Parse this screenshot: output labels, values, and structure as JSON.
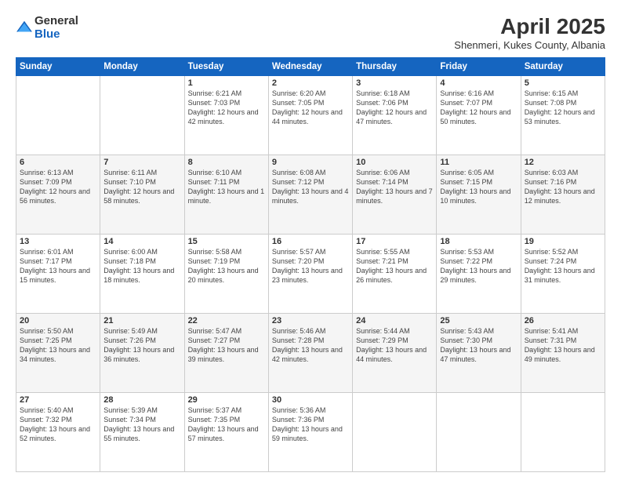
{
  "logo": {
    "text_general": "General",
    "text_blue": "Blue"
  },
  "title": "April 2025",
  "subtitle": "Shenmeri, Kukes County, Albania",
  "days": [
    "Sunday",
    "Monday",
    "Tuesday",
    "Wednesday",
    "Thursday",
    "Friday",
    "Saturday"
  ],
  "weeks": [
    [
      {
        "day": "",
        "info": ""
      },
      {
        "day": "",
        "info": ""
      },
      {
        "day": "1",
        "info": "Sunrise: 6:21 AM\nSunset: 7:03 PM\nDaylight: 12 hours and 42 minutes."
      },
      {
        "day": "2",
        "info": "Sunrise: 6:20 AM\nSunset: 7:05 PM\nDaylight: 12 hours and 44 minutes."
      },
      {
        "day": "3",
        "info": "Sunrise: 6:18 AM\nSunset: 7:06 PM\nDaylight: 12 hours and 47 minutes."
      },
      {
        "day": "4",
        "info": "Sunrise: 6:16 AM\nSunset: 7:07 PM\nDaylight: 12 hours and 50 minutes."
      },
      {
        "day": "5",
        "info": "Sunrise: 6:15 AM\nSunset: 7:08 PM\nDaylight: 12 hours and 53 minutes."
      }
    ],
    [
      {
        "day": "6",
        "info": "Sunrise: 6:13 AM\nSunset: 7:09 PM\nDaylight: 12 hours and 56 minutes."
      },
      {
        "day": "7",
        "info": "Sunrise: 6:11 AM\nSunset: 7:10 PM\nDaylight: 12 hours and 58 minutes."
      },
      {
        "day": "8",
        "info": "Sunrise: 6:10 AM\nSunset: 7:11 PM\nDaylight: 13 hours and 1 minute."
      },
      {
        "day": "9",
        "info": "Sunrise: 6:08 AM\nSunset: 7:12 PM\nDaylight: 13 hours and 4 minutes."
      },
      {
        "day": "10",
        "info": "Sunrise: 6:06 AM\nSunset: 7:14 PM\nDaylight: 13 hours and 7 minutes."
      },
      {
        "day": "11",
        "info": "Sunrise: 6:05 AM\nSunset: 7:15 PM\nDaylight: 13 hours and 10 minutes."
      },
      {
        "day": "12",
        "info": "Sunrise: 6:03 AM\nSunset: 7:16 PM\nDaylight: 13 hours and 12 minutes."
      }
    ],
    [
      {
        "day": "13",
        "info": "Sunrise: 6:01 AM\nSunset: 7:17 PM\nDaylight: 13 hours and 15 minutes."
      },
      {
        "day": "14",
        "info": "Sunrise: 6:00 AM\nSunset: 7:18 PM\nDaylight: 13 hours and 18 minutes."
      },
      {
        "day": "15",
        "info": "Sunrise: 5:58 AM\nSunset: 7:19 PM\nDaylight: 13 hours and 20 minutes."
      },
      {
        "day": "16",
        "info": "Sunrise: 5:57 AM\nSunset: 7:20 PM\nDaylight: 13 hours and 23 minutes."
      },
      {
        "day": "17",
        "info": "Sunrise: 5:55 AM\nSunset: 7:21 PM\nDaylight: 13 hours and 26 minutes."
      },
      {
        "day": "18",
        "info": "Sunrise: 5:53 AM\nSunset: 7:22 PM\nDaylight: 13 hours and 29 minutes."
      },
      {
        "day": "19",
        "info": "Sunrise: 5:52 AM\nSunset: 7:24 PM\nDaylight: 13 hours and 31 minutes."
      }
    ],
    [
      {
        "day": "20",
        "info": "Sunrise: 5:50 AM\nSunset: 7:25 PM\nDaylight: 13 hours and 34 minutes."
      },
      {
        "day": "21",
        "info": "Sunrise: 5:49 AM\nSunset: 7:26 PM\nDaylight: 13 hours and 36 minutes."
      },
      {
        "day": "22",
        "info": "Sunrise: 5:47 AM\nSunset: 7:27 PM\nDaylight: 13 hours and 39 minutes."
      },
      {
        "day": "23",
        "info": "Sunrise: 5:46 AM\nSunset: 7:28 PM\nDaylight: 13 hours and 42 minutes."
      },
      {
        "day": "24",
        "info": "Sunrise: 5:44 AM\nSunset: 7:29 PM\nDaylight: 13 hours and 44 minutes."
      },
      {
        "day": "25",
        "info": "Sunrise: 5:43 AM\nSunset: 7:30 PM\nDaylight: 13 hours and 47 minutes."
      },
      {
        "day": "26",
        "info": "Sunrise: 5:41 AM\nSunset: 7:31 PM\nDaylight: 13 hours and 49 minutes."
      }
    ],
    [
      {
        "day": "27",
        "info": "Sunrise: 5:40 AM\nSunset: 7:32 PM\nDaylight: 13 hours and 52 minutes."
      },
      {
        "day": "28",
        "info": "Sunrise: 5:39 AM\nSunset: 7:34 PM\nDaylight: 13 hours and 55 minutes."
      },
      {
        "day": "29",
        "info": "Sunrise: 5:37 AM\nSunset: 7:35 PM\nDaylight: 13 hours and 57 minutes."
      },
      {
        "day": "30",
        "info": "Sunrise: 5:36 AM\nSunset: 7:36 PM\nDaylight: 13 hours and 59 minutes."
      },
      {
        "day": "",
        "info": ""
      },
      {
        "day": "",
        "info": ""
      },
      {
        "day": "",
        "info": ""
      }
    ]
  ]
}
